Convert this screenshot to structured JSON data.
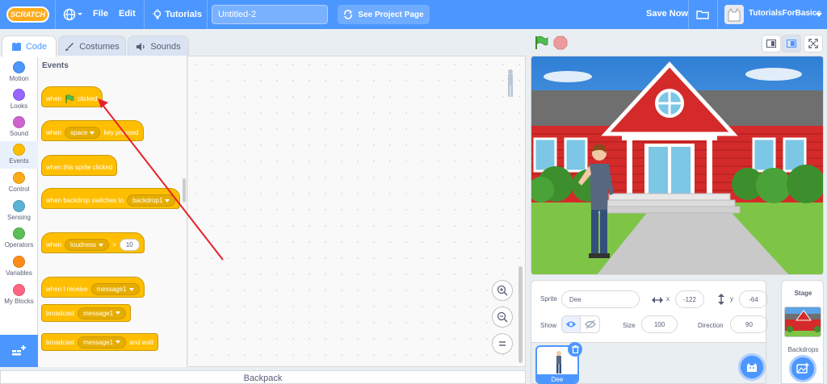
{
  "menubar": {
    "logo": "SCRATCH",
    "file": "File",
    "edit": "Edit",
    "tutorials": "Tutorials",
    "project_title": "Untitled-2",
    "see_project": "See Project Page",
    "save_now": "Save Now",
    "username": "TutorialsForBasics"
  },
  "tabs": {
    "code": "Code",
    "costumes": "Costumes",
    "sounds": "Sounds"
  },
  "categories": [
    {
      "label": "Motion",
      "color": "#4c97ff"
    },
    {
      "label": "Looks",
      "color": "#9966ff"
    },
    {
      "label": "Sound",
      "color": "#cf63cf"
    },
    {
      "label": "Events",
      "color": "#ffbf00"
    },
    {
      "label": "Control",
      "color": "#ffab19"
    },
    {
      "label": "Sensing",
      "color": "#5cb1d6"
    },
    {
      "label": "Operators",
      "color": "#59c059"
    },
    {
      "label": "Variables",
      "color": "#ff8c1a"
    },
    {
      "label": "My Blocks",
      "color": "#ff6680"
    }
  ],
  "palette": {
    "title": "Events",
    "b1_when": "when",
    "b1_clicked": "clicked",
    "b2_when": "when",
    "b2_key": "space",
    "b2_pressed": "key pressed",
    "b3": "when this sprite clicked",
    "b4_text": "when backdrop switches to",
    "b4_drop": "backdrop1",
    "b5_when": "when",
    "b5_drop": "loudness",
    "b5_op": ">",
    "b5_num": "10",
    "b6_text": "when I receive",
    "b6_drop": "message1",
    "b7_text": "broadcast",
    "b7_drop": "message1",
    "b8_text": "broadcast",
    "b8_drop": "message1",
    "b8_wait": "and wait"
  },
  "backpack": "Backpack",
  "sprite_info": {
    "sprite_label": "Sprite",
    "sprite_name": "Dee",
    "x_label": "x",
    "x_value": "-122",
    "y_label": "y",
    "y_value": "-64",
    "show_label": "Show",
    "size_label": "Size",
    "size_value": "100",
    "direction_label": "Direction",
    "direction_value": "90"
  },
  "sprite_list": {
    "sprite1": "Dee"
  },
  "stage_pane": {
    "title": "Stage",
    "backdrops": "Backdrops"
  },
  "colors": {
    "brand": "#4c97ff",
    "events": "#ffbf00",
    "annotation_arrow": "#e8202a"
  }
}
